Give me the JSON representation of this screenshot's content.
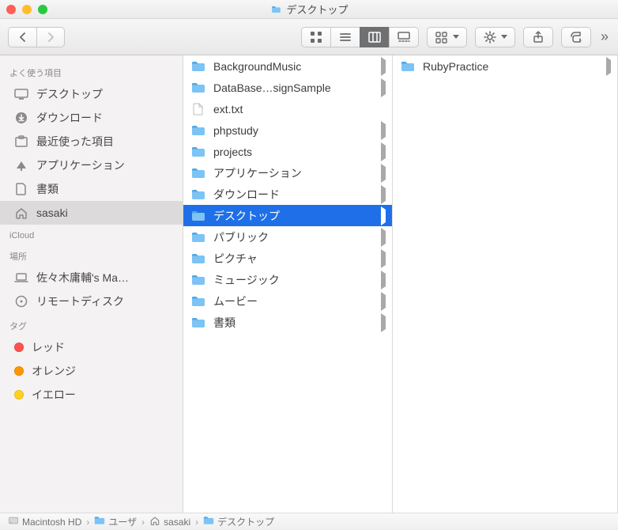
{
  "window": {
    "title": "デスクトップ"
  },
  "toolbar": {
    "view_active_index": 2
  },
  "sidebar": {
    "sections": [
      {
        "header": "よく使う項目",
        "items": [
          {
            "label": "デスクトップ",
            "icon": "desktop",
            "active": false
          },
          {
            "label": "ダウンロード",
            "icon": "download",
            "active": false
          },
          {
            "label": "最近使った項目",
            "icon": "recent",
            "active": false
          },
          {
            "label": "アプリケーション",
            "icon": "apps",
            "active": false
          },
          {
            "label": "書類",
            "icon": "doc",
            "active": false
          },
          {
            "label": "sasaki",
            "icon": "home",
            "active": true
          }
        ]
      },
      {
        "header": "iCloud",
        "items": []
      },
      {
        "header": "場所",
        "items": [
          {
            "label": "佐々木庸輔's Ma…",
            "icon": "laptop",
            "active": false
          },
          {
            "label": "リモートディスク",
            "icon": "disc",
            "active": false
          }
        ]
      },
      {
        "header": "タグ",
        "items": [
          {
            "label": "レッド",
            "icon": "dot",
            "color": "#ff534f",
            "active": false
          },
          {
            "label": "オレンジ",
            "icon": "dot",
            "color": "#ff9600",
            "active": false
          },
          {
            "label": "イエロー",
            "icon": "dot",
            "color": "#ffd21f",
            "active": false
          }
        ]
      }
    ]
  },
  "columns": [
    {
      "items": [
        {
          "name": "BackgroundMusic",
          "type": "folder",
          "has_children": true,
          "selected": false
        },
        {
          "name": "DataBase…signSample",
          "type": "folder",
          "has_children": true,
          "selected": false
        },
        {
          "name": "ext.txt",
          "type": "file",
          "has_children": false,
          "selected": false
        },
        {
          "name": "phpstudy",
          "type": "folder",
          "has_children": true,
          "selected": false
        },
        {
          "name": "projects",
          "type": "folder",
          "has_children": true,
          "selected": false
        },
        {
          "name": "アプリケーション",
          "type": "folder",
          "has_children": true,
          "selected": false
        },
        {
          "name": "ダウンロード",
          "type": "folder-badge",
          "has_children": true,
          "selected": false
        },
        {
          "name": "デスクトップ",
          "type": "folder",
          "has_children": true,
          "selected": true
        },
        {
          "name": "パブリック",
          "type": "folder",
          "has_children": true,
          "selected": false
        },
        {
          "name": "ピクチャ",
          "type": "folder-badge",
          "has_children": true,
          "selected": false
        },
        {
          "name": "ミュージック",
          "type": "folder-badge",
          "has_children": true,
          "selected": false
        },
        {
          "name": "ムービー",
          "type": "folder-badge",
          "has_children": true,
          "selected": false
        },
        {
          "name": "書類",
          "type": "folder",
          "has_children": true,
          "selected": false
        }
      ]
    },
    {
      "items": [
        {
          "name": "RubyPractice",
          "type": "folder",
          "has_children": true,
          "selected": false
        }
      ]
    }
  ],
  "pathbar": {
    "items": [
      {
        "label": "Macintosh HD",
        "icon": "hdd"
      },
      {
        "label": "ユーザ",
        "icon": "folder"
      },
      {
        "label": "sasaki",
        "icon": "home"
      },
      {
        "label": "デスクトップ",
        "icon": "folder"
      }
    ]
  }
}
